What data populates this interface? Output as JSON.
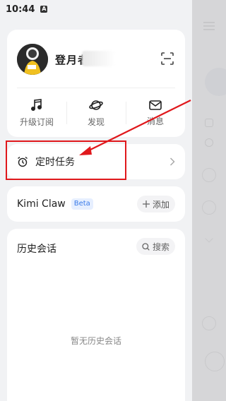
{
  "status_bar": {
    "time": "10:44",
    "notification_badge": "A"
  },
  "profile": {
    "username": "登月者",
    "avatar": "user-avatar"
  },
  "quick_actions": [
    {
      "label": "升级订阅",
      "icon": "music-note-icon"
    },
    {
      "label": "发现",
      "icon": "planet-icon"
    },
    {
      "label": "消息",
      "icon": "mail-icon"
    }
  ],
  "scheduled_tasks": {
    "label": "定时任务",
    "icon": "alarm-clock-icon"
  },
  "kimi_claw": {
    "label": "Kimi Claw",
    "badge": "Beta",
    "add_label": "添加"
  },
  "history": {
    "title": "历史会话",
    "search_label": "搜索",
    "empty_text": "暂无历史会话"
  },
  "colors": {
    "accent_blue": "#3a7be8",
    "annotation_red": "#e0181c",
    "card_bg": "#ffffff",
    "page_bg": "#f1f2f4"
  }
}
